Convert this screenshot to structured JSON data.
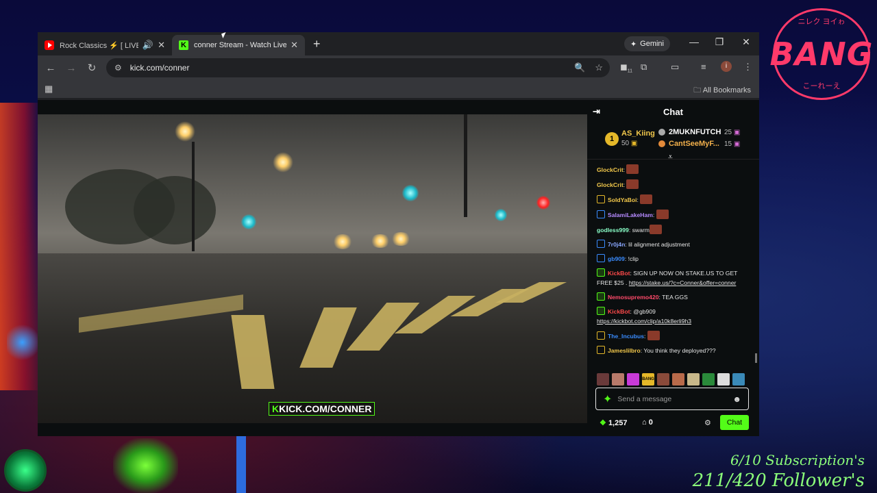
{
  "overlay": {
    "bang_logo": "BANG",
    "bang_top_text": "ニレク ヨイゎ",
    "bang_bottom_text": "こーれーえ",
    "subscriptions": "6/10 Subscription's",
    "followers": "211/420 Follower's"
  },
  "browser": {
    "tabs": [
      {
        "title": "Rock Classics ⚡ [ LIVE ] Ti",
        "active": false,
        "icon": "youtube-icon"
      },
      {
        "title": "conner Stream - Watch Live on",
        "active": true,
        "icon": "kick-icon"
      }
    ],
    "gemini_label": "Gemini",
    "url": "kick.com/conner",
    "extension_badge": "11",
    "profile_initial": "i",
    "all_bookmarks": "All Bookmarks"
  },
  "video": {
    "watermark_k": "K",
    "watermark_text": "KICK.COM/CONNER"
  },
  "chat": {
    "title": "Chat",
    "leaderboard": {
      "rank": "1",
      "top_name": "AS_Kiing",
      "top_value": "50",
      "rows": [
        {
          "name": "2MUKNFUTCH",
          "value": "25"
        },
        {
          "name": "CantSeeMyF...",
          "value": "15"
        }
      ]
    },
    "messages": [
      {
        "user": "GlockCrit",
        "text": "",
        "color": "#f2c84b",
        "badge": "",
        "emote": true
      },
      {
        "user": "GlockCrit",
        "text": "",
        "color": "#f2c84b",
        "badge": "",
        "emote": true
      },
      {
        "user": "SoldYaBoi",
        "text": "",
        "color": "#f2c84b",
        "badge": "y",
        "emote": true
      },
      {
        "user": "SalamiLakeHam",
        "text": "",
        "color": "#b58aff",
        "badge": "b",
        "emote": true
      },
      {
        "user": "godless999",
        "text": "swarm",
        "color": "#8affc8",
        "badge": "",
        "emote": true
      },
      {
        "user": "7r0j4n",
        "text": "lil alignment adjustment",
        "color": "#8aa8ff",
        "badge": "b",
        "emote": false
      },
      {
        "user": "gb909",
        "text": "!clip",
        "color": "#3a8cff",
        "badge": "b",
        "emote": false
      },
      {
        "user": "KickBot",
        "text": "SIGN UP NOW ON STAKE.US TO GET FREE $25 . ",
        "link": "https://stake.us/?c=Conner&offer=conner",
        "color": "#ff4a4a",
        "badge": "g",
        "emote": false
      },
      {
        "user": "Nemosupremo420",
        "text": "TEA GGS",
        "color": "#ff4a6a",
        "badge": "g",
        "emote": false
      },
      {
        "user": "KickBot",
        "text": "@gb909 ",
        "link": "https://kickbot.com/clip/a10k8erli9h3",
        "color": "#ff4a4a",
        "badge": "g",
        "emote": false
      },
      {
        "user": "The_Incubus",
        "text": "",
        "color": "#3a8cff",
        "badge": "y",
        "emote": true
      },
      {
        "user": "Jameslilbro",
        "text": "You think they deployed???",
        "color": "#f2c84b",
        "badge": "y",
        "emote": false
      }
    ],
    "emotes_bar_labels": [
      "",
      "",
      "",
      "BANG",
      "",
      "",
      "",
      "",
      "",
      ""
    ],
    "input_placeholder": "Send a message",
    "points": "1,257",
    "shop_count": "0",
    "send_label": "Chat"
  }
}
